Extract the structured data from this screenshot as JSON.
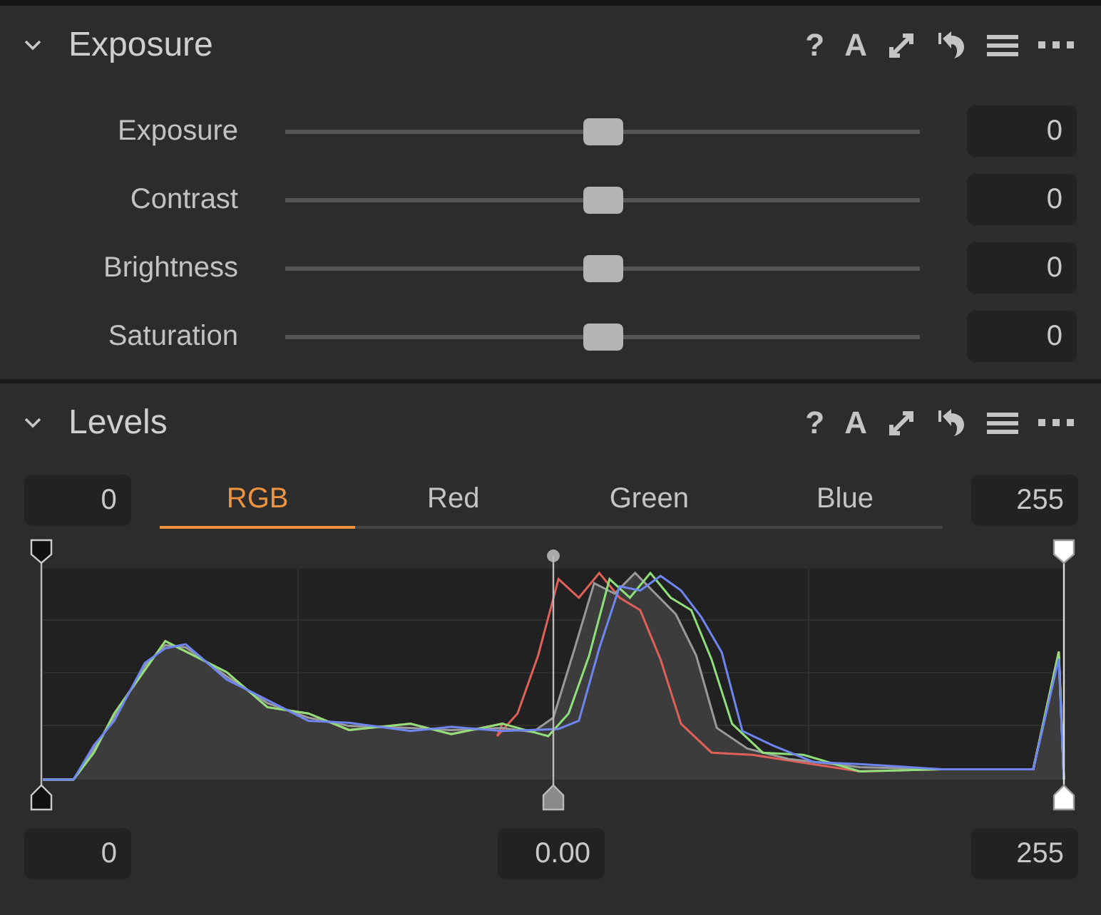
{
  "exposure": {
    "title": "Exposure",
    "expanded": true,
    "tools": [
      "?",
      "A"
    ],
    "sliders": [
      {
        "label": "Exposure",
        "level": 0.5,
        "value": "0"
      },
      {
        "label": "Contrast",
        "level": 0.5,
        "value": "0"
      },
      {
        "label": "Brightness",
        "level": 0.5,
        "value": "0"
      },
      {
        "label": "Saturation",
        "level": 0.5,
        "value": "0"
      }
    ]
  },
  "levels": {
    "title": "Levels",
    "expanded": true,
    "tools": [
      "?",
      "A"
    ],
    "input_low": "0",
    "input_high": "255",
    "tabs": [
      {
        "label": "RGB",
        "selected": true
      },
      {
        "label": "Red",
        "selected": false
      },
      {
        "label": "Green",
        "selected": false
      },
      {
        "label": "Blue",
        "selected": false
      }
    ],
    "output_low": "0",
    "midpoint": "0.00",
    "output_high": "255"
  }
}
